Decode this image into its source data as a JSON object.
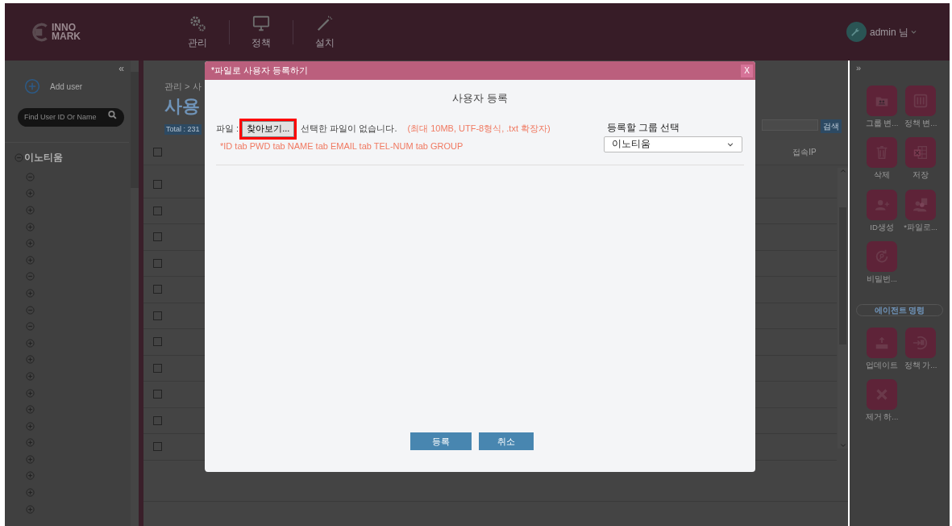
{
  "header": {
    "logo": [
      "INNO",
      "MARK"
    ],
    "nav": [
      {
        "label": "관리",
        "kind": "gears"
      },
      {
        "label": "정책",
        "kind": "monitor"
      },
      {
        "label": "설치",
        "kind": "wand"
      }
    ],
    "user": "admin 님"
  },
  "sidebar": {
    "collapse": "«",
    "add_user": "Add user",
    "search": {
      "placeholder": "Find User ID Or Name"
    },
    "tree": {
      "label": "이노티움",
      "expanded": true,
      "children": [
        {
          "expanded": true
        },
        {
          "expanded": false
        },
        {
          "expanded": false
        },
        {
          "expanded": false
        },
        {
          "expanded": false
        },
        {
          "expanded": false
        },
        {
          "expanded": true
        },
        {
          "expanded": false
        },
        {
          "expanded": true
        },
        {
          "expanded": true
        },
        {
          "expanded": false
        },
        {
          "expanded": false
        },
        {
          "expanded": false
        },
        {
          "expanded": false
        },
        {
          "expanded": false
        },
        {
          "expanded": false
        },
        {
          "expanded": false
        },
        {
          "expanded": false
        },
        {
          "expanded": false
        },
        {
          "expanded": false
        },
        {
          "expanded": false
        }
      ]
    }
  },
  "main": {
    "breadcrumb": "관리 > 사",
    "title": "사용",
    "total": "Total : 231",
    "search_button": "검색",
    "table": {
      "header": {
        "checked": false
      },
      "columns": [
        "접속IP"
      ],
      "rows": [
        {
          "checked": false
        },
        {
          "checked": false
        },
        {
          "checked": false
        },
        {
          "checked": false
        },
        {
          "checked": false
        },
        {
          "checked": false
        },
        {
          "checked": false
        },
        {
          "checked": false
        },
        {
          "checked": false
        },
        {
          "checked": false
        },
        {
          "checked": false
        }
      ]
    }
  },
  "actions": {
    "expand": "»",
    "buttons": [
      {
        "label": "그룹 변...",
        "kind": "folder"
      },
      {
        "label": "정책 변...",
        "kind": "sliders"
      },
      {
        "label": "삭제",
        "kind": "trash"
      },
      {
        "label": "저장",
        "kind": "sheet"
      },
      {
        "label": "ID생성",
        "kind": "user-plus"
      },
      {
        "label": "*파일로...",
        "kind": "users"
      },
      {
        "label": "비밀번...",
        "kind": "key"
      }
    ],
    "agent_section": "에이전트 명령",
    "agent_buttons": [
      {
        "label": "업데이트",
        "kind": "upload"
      },
      {
        "label": "정책 가...",
        "kind": "import"
      },
      {
        "label": "제거 하...",
        "kind": "x"
      }
    ]
  },
  "dialog": {
    "title": "*파일로 사용자 등록하기",
    "close": "X",
    "heading": "사용자 등록",
    "file_label": "파일 :",
    "browse": {
      "label": "찾아보기...",
      "highlighted": true
    },
    "file_status": "선택한 파일이 없습니다.",
    "file_hint": "(최대 10MB, UTF-8형식, .txt 확장자)",
    "format_hint": "*ID tab PWD tab NAME tab EMAIL tab TEL-NUM tab GROUP",
    "group_label": "등록할 그룹 선택",
    "group_value": "이노티움",
    "buttons": [
      "등록",
      "취소"
    ]
  }
}
